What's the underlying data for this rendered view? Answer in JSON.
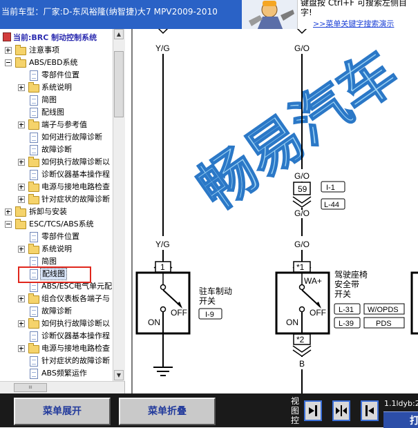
{
  "header": {
    "car_model": "当前车型：厂家:D-东风裕隆(纳智捷)大7 MPV2009-2010",
    "tip_line1": "键盘按   Ctrl+F  可搜索左侧目",
    "tip_line2": "字!",
    "tip_link": ">>菜单关键字搜索演示"
  },
  "tree": {
    "current_system": "当前:BRC 制动控制系统",
    "items": [
      {
        "label": "注意事项"
      },
      {
        "label": "ABS/EBD系统"
      },
      {
        "label": "零部件位置"
      },
      {
        "label": "系统说明"
      },
      {
        "label": "简图"
      },
      {
        "label": "配线图"
      },
      {
        "label": "端子与参考值"
      },
      {
        "label": "如何进行故障诊断"
      },
      {
        "label": "故障诊断"
      },
      {
        "label": "如何执行故障诊断以"
      },
      {
        "label": "诊断仪器基本操作程"
      },
      {
        "label": "电源与接地电路检查"
      },
      {
        "label": "针对症状的故障诊断"
      },
      {
        "label": "拆卸与安装"
      },
      {
        "label": "ESC/TCS/ABS系统"
      },
      {
        "label": "零部件位置"
      },
      {
        "label": "系统说明"
      },
      {
        "label": "简图"
      },
      {
        "label": "配线图"
      },
      {
        "label": "ABS/ESC电气单元配"
      },
      {
        "label": "组合仪表板各端子与"
      },
      {
        "label": "故障诊断"
      },
      {
        "label": "如何执行故障诊断以"
      },
      {
        "label": "诊断仪器基本操作程"
      },
      {
        "label": "电源与接地电路检查"
      },
      {
        "label": "针对症状的故障诊断"
      },
      {
        "label": "ABS频繁运作"
      }
    ],
    "hscroll_grip": "III"
  },
  "diagram": {
    "watermark": "畅易汽车",
    "wire_yg_top": "Y/G",
    "wire_go_top": "G/O",
    "wire_go_mid": "G/O",
    "conn_59": "59",
    "conn_i1": "I-1",
    "conn_l44": "L-44",
    "wire_go_low": "G/O",
    "wire_go_low2": "G/O",
    "wire_yg_low": "Y/G",
    "pin_1": "1",
    "pin_star1": "*1",
    "pin_star2": "*2",
    "wa_plus": "WA+",
    "on_left": "ON",
    "off_left": "OFF",
    "on_right": "ON",
    "off_right": "OFF",
    "parking_line1": "驻车制动",
    "parking_line2": "开关",
    "conn_i9": "I-9",
    "seatbelt_line1": "驾驶座椅",
    "seatbelt_line2": "安全带",
    "seatbelt_line3": "开关",
    "conn_l31": "L-31",
    "wopds": "W/OPDS",
    "conn_l39": "L-39",
    "pds": "PDS",
    "wire_b": "B"
  },
  "footer": {
    "expand_button": "菜单展开",
    "collapse_button": "菜单折叠",
    "view_label": "视图控",
    "extra_label": "1.1ldyb:2",
    "extra_button": "打"
  }
}
